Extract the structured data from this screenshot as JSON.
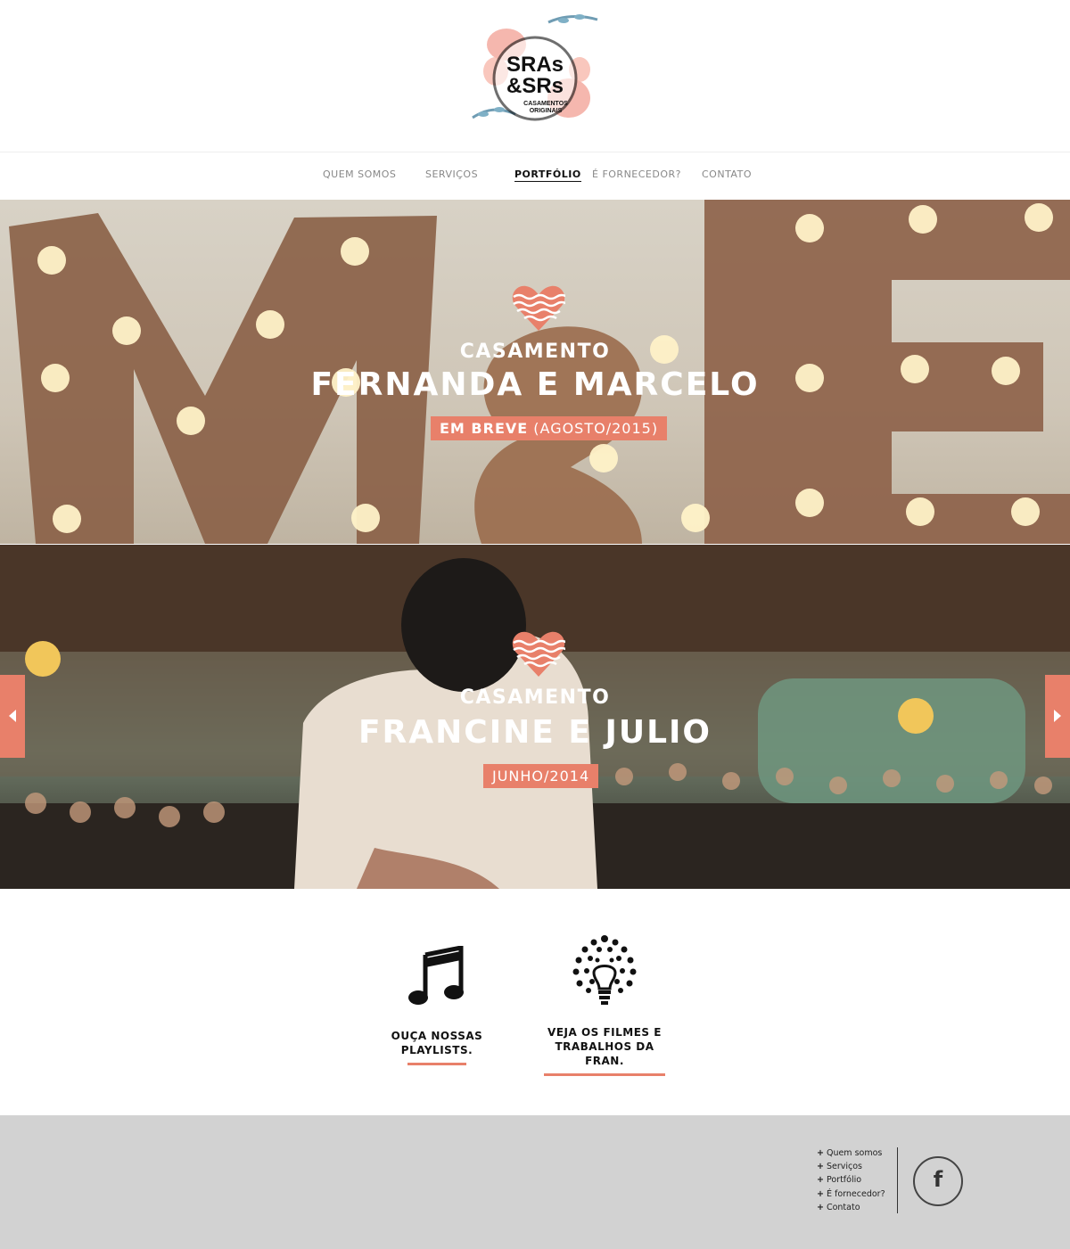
{
  "logo": {
    "line1": "SRAs",
    "line2": "&SRs",
    "tagline1": "CASAMENTOS",
    "tagline2": "ORIGINAIS"
  },
  "nav": {
    "items": [
      {
        "label": "QUEM SOMOS",
        "active": false
      },
      {
        "label": "SERVIÇOS",
        "active": false
      },
      {
        "label": "PORTFÓLIO",
        "active": true
      },
      {
        "label": "É FORNECEDOR?",
        "active": false
      },
      {
        "label": "CONTATO",
        "active": false
      }
    ]
  },
  "banners": [
    {
      "kicker": "CASAMENTO",
      "names": "FERNANDA E MARCELO",
      "tag_bold": "EM BREVE",
      "tag_rest": "(AGOSTO/2015)"
    },
    {
      "kicker": "CASAMENTO",
      "names": "FRANCINE E JULIO",
      "tag_bold": "",
      "tag_rest": "JUNHO/2014"
    }
  ],
  "carousel": {
    "prev_icon": "arrow-left-icon",
    "next_icon": "arrow-right-icon"
  },
  "features": [
    {
      "icon": "music-note-icon",
      "line1": "OUÇA NOSSAS",
      "line2": "PLAYLISTS."
    },
    {
      "icon": "lightbulb-icon",
      "line1": "VEJA OS FILMES E",
      "line2": "TRABALHOS DA FRAN."
    }
  ],
  "footer": {
    "links": [
      "Quem somos",
      "Serviços",
      "Portfólio",
      "É fornecedor?",
      "Contato"
    ],
    "facebook_icon": "facebook-icon",
    "facebook_glyph": "f"
  },
  "colors": {
    "accent": "#e8806a",
    "footer_bg": "#d2d2d2"
  }
}
